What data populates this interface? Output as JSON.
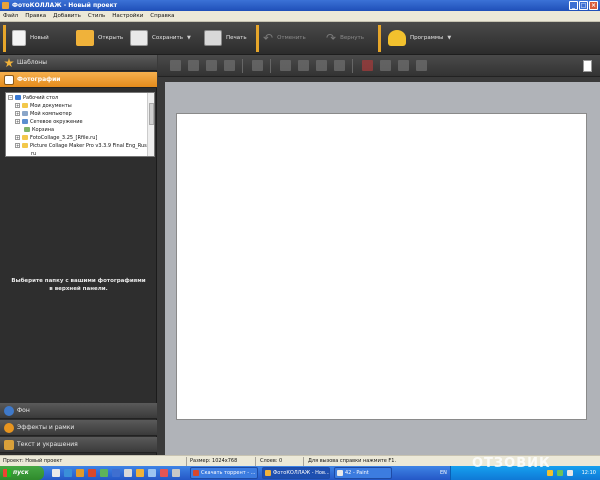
{
  "window": {
    "title": "ФотоКОЛЛАЖ - Новый проект"
  },
  "menu": [
    "Файл",
    "Правка",
    "Добавить",
    "Стиль",
    "Настройки",
    "Справка"
  ],
  "toolbar": {
    "new_label": "Новый",
    "open_label": "Открыть",
    "save_label": "Сохранить",
    "print_label": "Печать",
    "undo_label": "Отменить",
    "redo_label": "Вернуть",
    "programs_label": "Программы"
  },
  "left_panel": {
    "templates_label": "Шаблоны",
    "photos_label": "Фотографии",
    "tree": [
      "Рабочий стол",
      "Мои документы",
      "Мой компьютер",
      "Сетевое окружение",
      "Корзина",
      "FotoCollage_3.25_[Rfile.ru]",
      "Picture Collage Maker Pro v3.3.9 Final Eng_Rus",
      "ru"
    ],
    "hint_line1": "Выберите папку с вашими фотографиями",
    "hint_line2": "в верхней панели.",
    "background_label": "Фон",
    "effects_label": "Эффекты и рамки",
    "text_label": "Текст и украшения"
  },
  "status": {
    "project": "Проект: Новый проект",
    "size": "Размер: 1024x768",
    "layers": "Слоев: 0",
    "help": "Для вызова справки нажмите F1."
  },
  "taskbar": {
    "start_label": "пуск",
    "task1": "Скачать торрент - ...",
    "task2": "ФотоКОЛЛАЖ - Нов...",
    "task3": "42 - Paint",
    "lang": "EN",
    "clock": "12:10"
  },
  "watermark": "ОТЗОВИК",
  "colors": {
    "accent": "#e8951f",
    "panel_bg": "#2e2e2e",
    "workspace_bg": "#b0b3b8"
  }
}
